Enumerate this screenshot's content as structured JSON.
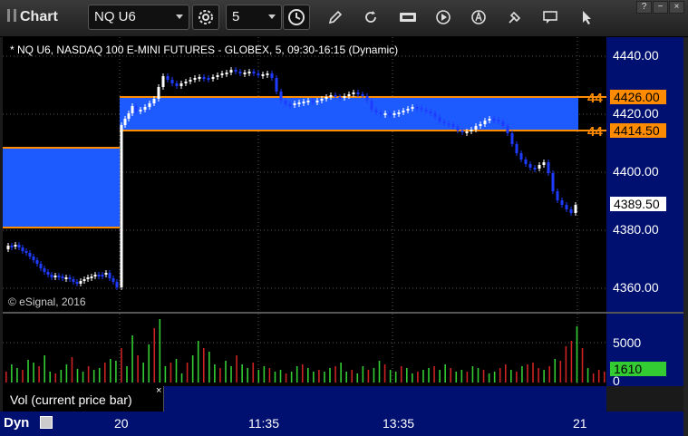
{
  "app": {
    "title": "Chart"
  },
  "toolbar": {
    "symbol_value": "NQ U6",
    "interval_value": "5"
  },
  "chart": {
    "caption": "* NQ U6, NASDAQ 100 E-MINI FUTURES - GLOBEX, 5, 09:30-16:15 (Dynamic)",
    "copyright": "© eSignal, 2016",
    "price_ticks": [
      "4440.00",
      "4420.00",
      "4400.00",
      "4380.00",
      "4360.00"
    ],
    "price_tags": [
      {
        "label": "4426.00",
        "bg": "#ff8c00",
        "fg": "#000000"
      },
      {
        "label": "4414.50",
        "bg": "#ff8c00",
        "fg": "#000000"
      },
      {
        "label": "4389.50",
        "bg": "#ffffff",
        "fg": "#000000"
      }
    ],
    "zone_labels": [
      "44",
      "44"
    ],
    "colors": {
      "zone": "#1e5bff",
      "zone_border": "#ff8c00",
      "up_candle": "#ffffff",
      "down_candle": "#1e3cff",
      "vol_up": "#33cc33",
      "vol_down": "#cc2222",
      "axis_bg": "#001071"
    }
  },
  "volume": {
    "ticks": [
      "5000",
      "0"
    ],
    "current_tag": {
      "label": "1610",
      "bg": "#33cc33",
      "fg": "#000000"
    },
    "legend_label": "Vol (current price bar)",
    "legend_close": "×"
  },
  "time_axis": {
    "labels": [
      "20",
      "11:35",
      "13:35",
      "21"
    ],
    "mode_label": "Dyn"
  }
}
